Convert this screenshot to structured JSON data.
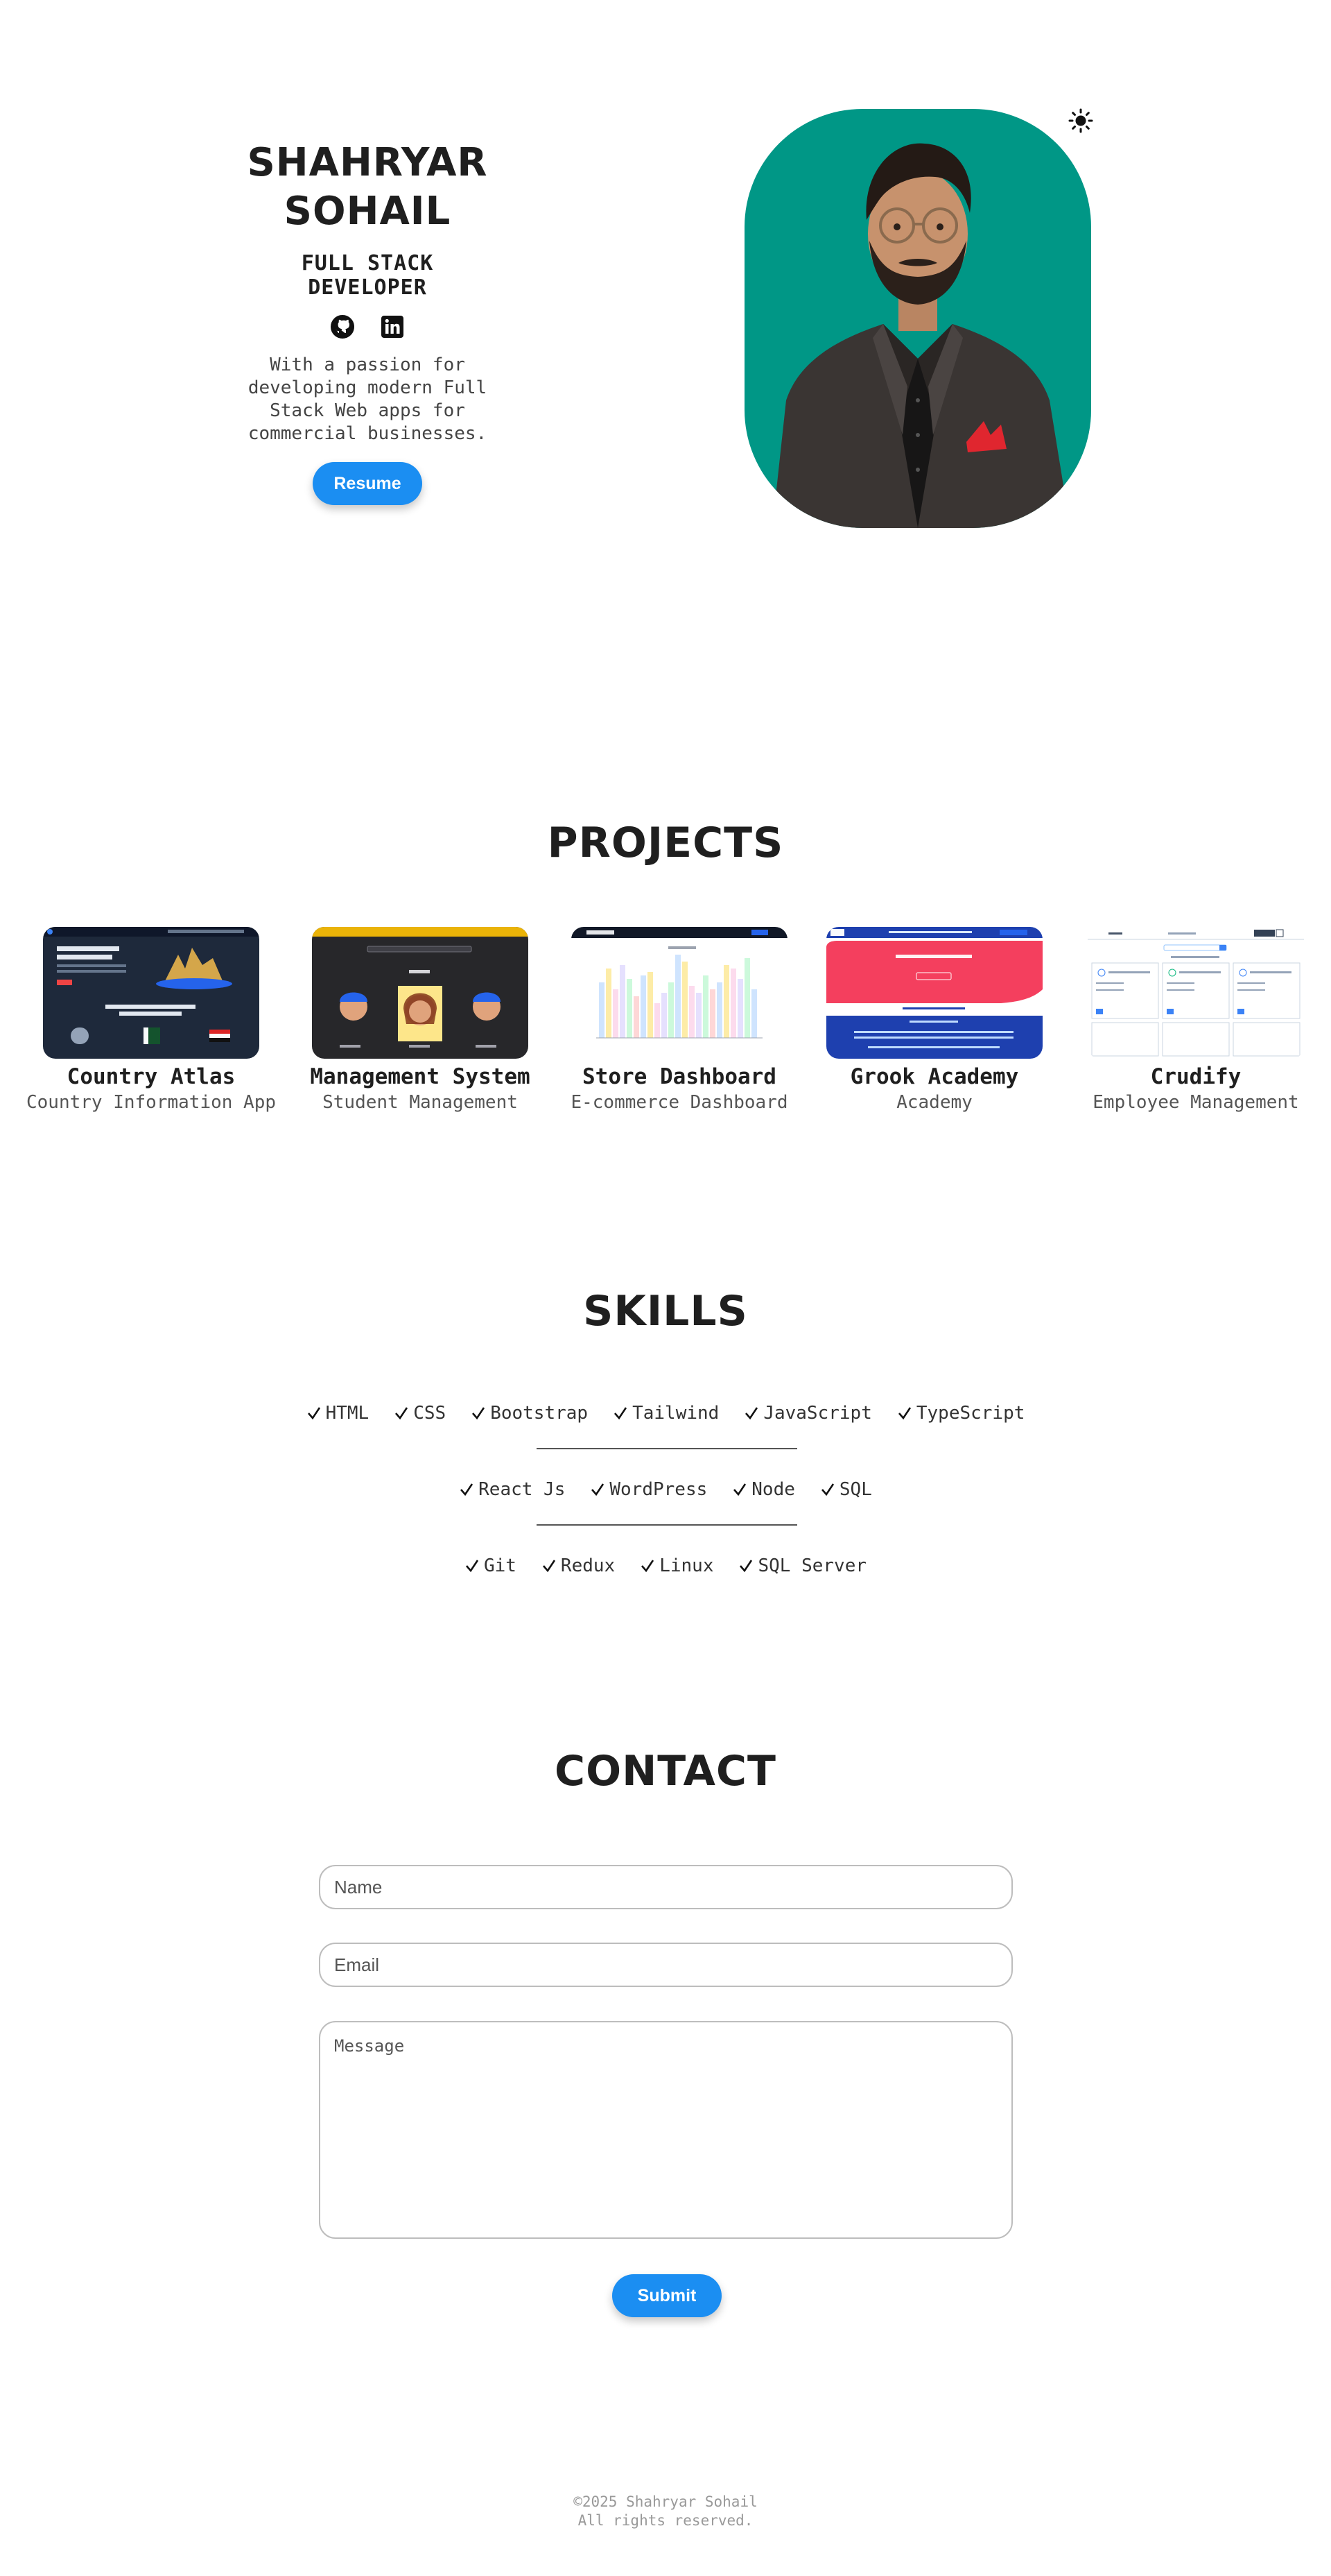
{
  "theme_toggle": {
    "icon": "sun-icon"
  },
  "hero": {
    "name_line1": "SHAHRYAR",
    "name_line2": "SOHAIL",
    "role": "FULL STACK DEVELOPER",
    "socials": [
      {
        "icon": "github-icon"
      },
      {
        "icon": "linkedin-icon"
      }
    ],
    "tagline": "With a passion for developing modern Full Stack Web apps for commercial businesses.",
    "resume_label": "Resume",
    "portrait_bg": "#009786"
  },
  "projects": {
    "title": "PROJECTS",
    "items": [
      {
        "name": "Country Atlas",
        "description": "Country Information App"
      },
      {
        "name": "Management System",
        "description": "Student Management"
      },
      {
        "name": "Store Dashboard",
        "description": "E-commerce Dashboard"
      },
      {
        "name": "Grook Academy",
        "description": "Academy"
      },
      {
        "name": "Crudify",
        "description": "Employee Management"
      }
    ]
  },
  "skills": {
    "title": "SKILLS",
    "rows": [
      [
        "HTML",
        "CSS",
        "Bootstrap",
        "Tailwind",
        "JavaScript",
        "TypeScript"
      ],
      [
        "React Js",
        "WordPress",
        "Node",
        "SQL"
      ],
      [
        "Git",
        "Redux",
        "Linux",
        "SQL Server"
      ]
    ]
  },
  "contact": {
    "title": "CONTACT",
    "name_placeholder": "Name",
    "email_placeholder": "Email",
    "message_placeholder": "Message",
    "submit_label": "Submit"
  },
  "footer": {
    "copyright": "©2025 Shahryar Sohail",
    "rights": "All rights reserved."
  },
  "colors": {
    "accent": "#1b8ef2",
    "text": "#1f1f1f",
    "portrait_bg": "#009786"
  }
}
